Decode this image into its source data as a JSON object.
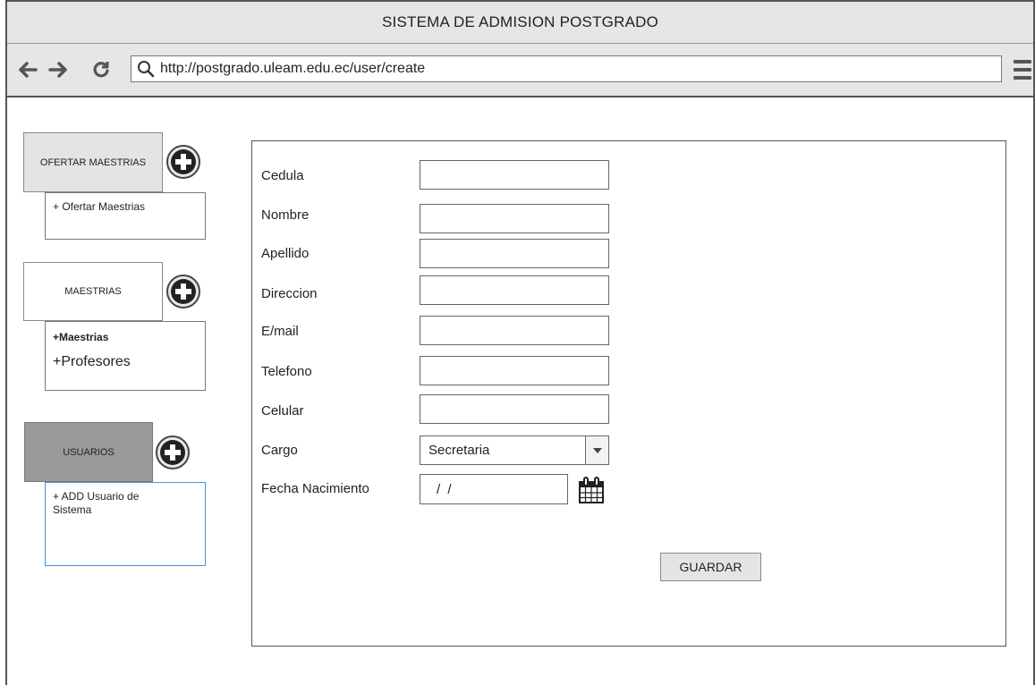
{
  "window": {
    "title": "SISTEMA DE ADMISION POSTGRADO"
  },
  "navbar": {
    "back_icon": "back-arrow-icon",
    "forward_icon": "forward-arrow-icon",
    "reload_icon": "reload-icon",
    "url": "http://postgrado.uleam.edu.ec/user/create",
    "menu_icon": "hamburger-menu-icon"
  },
  "sidebar": {
    "sections": [
      {
        "label": "OFERTAR MAESTRIAS",
        "items": [
          "+ Ofertar Maestrias"
        ]
      },
      {
        "label": "MAESTRIAS",
        "items": [
          "+Maestrias",
          "+Profesores"
        ]
      },
      {
        "label": "USUARIOS",
        "items": [
          "+ ADD Usuario de Sistema"
        ]
      }
    ]
  },
  "form": {
    "fields": [
      {
        "label": "Cedula",
        "value": ""
      },
      {
        "label": "Nombre",
        "value": ""
      },
      {
        "label": "Apellido",
        "value": ""
      },
      {
        "label": "Direccion",
        "value": ""
      },
      {
        "label": "E/mail",
        "value": ""
      },
      {
        "label": "Telefono",
        "value": ""
      },
      {
        "label": "Celular",
        "value": ""
      }
    ],
    "cargo": {
      "label": "Cargo",
      "selected": "Secretaria"
    },
    "fecha": {
      "label": "Fecha Nacimiento",
      "value": "/ /"
    },
    "save_label": "GUARDAR"
  },
  "colors": {
    "titlebar_bg": "#e6e6e6",
    "active_tab_bg": "#9a9a9a",
    "selected_box_border": "#4a90d9"
  }
}
